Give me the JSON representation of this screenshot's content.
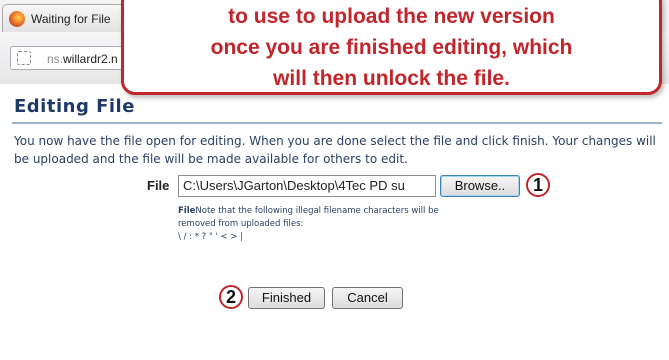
{
  "browser": {
    "tab_title": "Waiting for File",
    "url_prefix": "ns.",
    "url_host": "willardr2.n"
  },
  "callout": {
    "line1": "to use to upload the new version",
    "line2": "once you are finished editing, which",
    "line3": "will then unlock the file."
  },
  "page": {
    "title": "Editing File",
    "description": "You now have the file open for editing. When you are done select the file and click finish. Your changes will be uploaded and the file will be made available for others to edit."
  },
  "form": {
    "file_label": "File",
    "file_value": "C:\\Users\\JGarton\\Desktop\\4Tec PD su",
    "browse_label": "Browse..",
    "note_lead": "File",
    "note_text": "Note that the following illegal filename characters will be removed from uploaded files:",
    "illegal_chars": "\\ / : * ? \" ' < > |",
    "finished_label": "Finished",
    "cancel_label": "Cancel"
  },
  "markers": {
    "one": "1",
    "two": "2"
  },
  "colors": {
    "callout_red": "#c0262b",
    "heading_blue": "#1f3a66"
  }
}
